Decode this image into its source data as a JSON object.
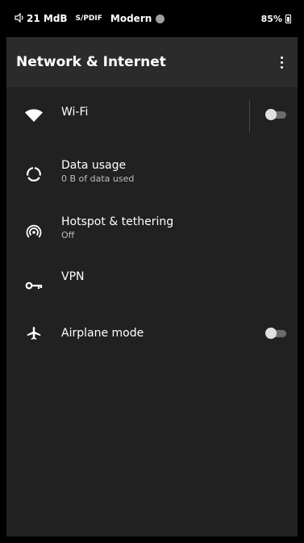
{
  "status_bar": {
    "volume": "21 MdB",
    "audio_output": "S/PDIF",
    "mode": "Modern",
    "battery": "85%"
  },
  "header": {
    "title": "Network & Internet"
  },
  "items": [
    {
      "title": "Wi-Fi",
      "subtitle": "",
      "icon": "wifi-icon",
      "toggle": false
    },
    {
      "title": "Data usage",
      "subtitle": "0 B of data used",
      "icon": "data-usage-icon"
    },
    {
      "title": "Hotspot & tethering",
      "subtitle": "Off",
      "icon": "hotspot-icon"
    },
    {
      "title": "VPN",
      "subtitle": "",
      "icon": "vpn-key-icon"
    },
    {
      "title": "Airplane mode",
      "subtitle": "",
      "icon": "airplane-icon",
      "toggle": false
    }
  ],
  "colors": {
    "background": "#212121",
    "app_bar": "#2b2b2b",
    "toggle_off_track": "#6b6b6b",
    "toggle_off_thumb": "#e0e0e0"
  }
}
